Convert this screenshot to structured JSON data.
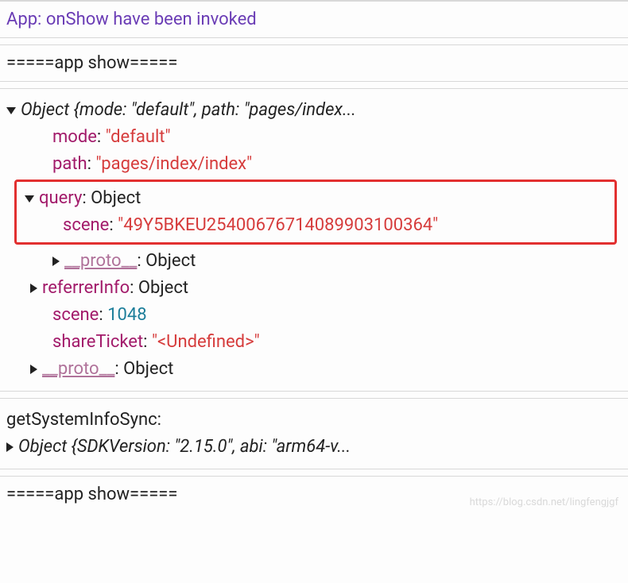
{
  "line1": "App: onShow have been invoked",
  "line2": "=====app show=====",
  "obj_header": "Object {mode: \"default\", path: \"pages/index...",
  "mode_key": "mode",
  "mode_value": "\"default\"",
  "path_key": "path",
  "path_value": "\"pages/index/index\"",
  "query_key": "query",
  "query_type": ": Object",
  "scene_key": "scene",
  "scene_value": "\"49Y5BKEU254006767140899031003​64\"",
  "proto_key": "__proto__",
  "proto_type": ": Object",
  "referrer_key": "referrerInfo",
  "referrer_type": ": Object",
  "scene2_key": "scene",
  "scene2_value": "1048",
  "shareTicket_key": "shareTicket",
  "shareTicket_value": "\"<Undefined>\"",
  "proto2_key": "__proto__",
  "proto2_type": ": Object",
  "sysinfo_label": "getSystemInfoSync:",
  "sysinfo_obj": "Object {SDKVersion: \"2.15.0\", abi: \"arm64-v...",
  "line_footer": "=====app show=====",
  "watermark": "https://blog.csdn.net/lingfengjgf"
}
